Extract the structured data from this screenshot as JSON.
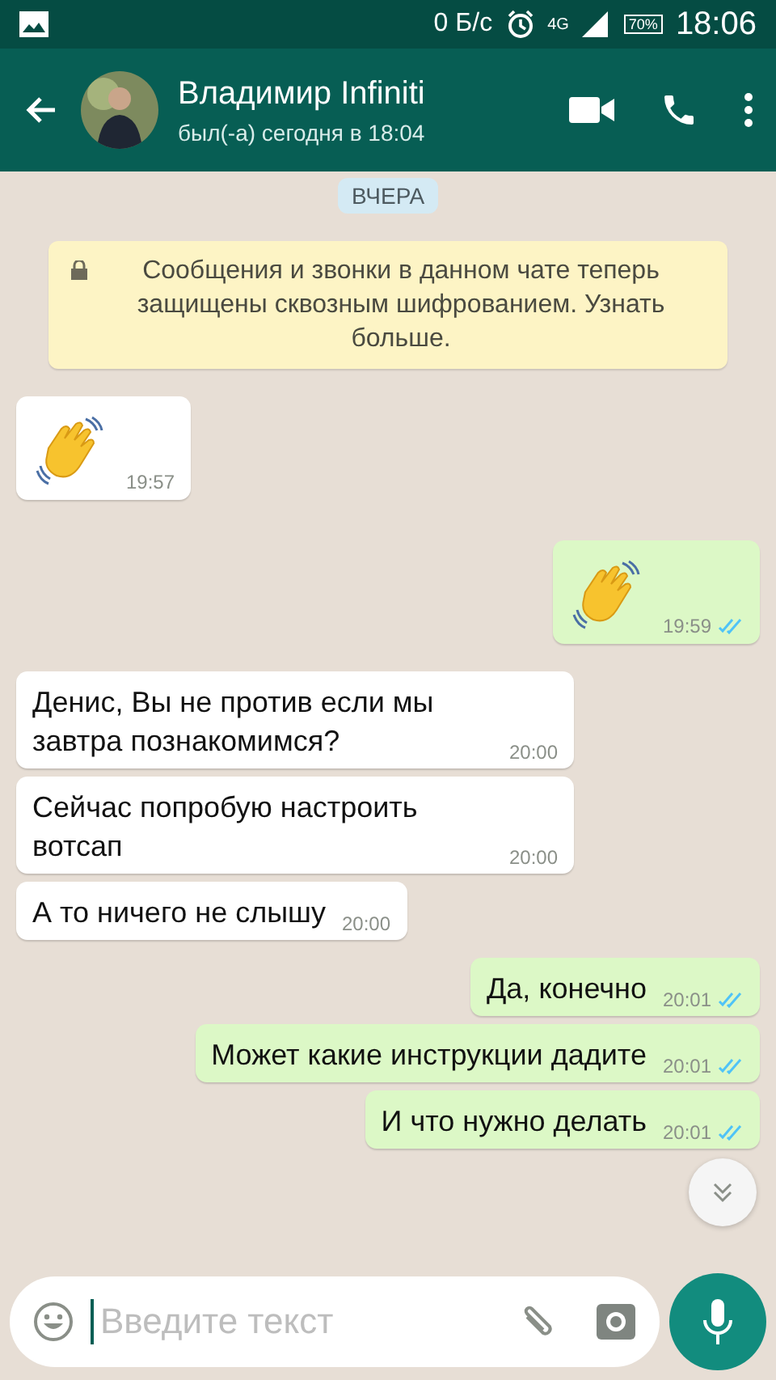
{
  "status_bar": {
    "speed": "0 Б/с",
    "network": "4G",
    "battery": "70%",
    "time": "18:06"
  },
  "header": {
    "name": "Владимир Infiniti",
    "last_seen": "был(-а) сегодня в 18:04"
  },
  "date_chip": "ВЧЕРА",
  "notice": "Сообщения и звонки в данном чате теперь защищены сквозным шифрованием. Узнать больше.",
  "messages": [
    {
      "kind": "emoji",
      "outgoing": false,
      "time": "19:57"
    },
    {
      "kind": "emoji",
      "outgoing": true,
      "time": "19:59",
      "read": true
    },
    {
      "kind": "text",
      "outgoing": false,
      "text": "Денис, Вы не против если мы завтра познакомимся?",
      "time": "20:00"
    },
    {
      "kind": "text",
      "outgoing": false,
      "text": "Сейчас попробую настроить вотсап",
      "time": "20:00"
    },
    {
      "kind": "text",
      "outgoing": false,
      "text": "А то ничего не слышу",
      "time": "20:00"
    },
    {
      "kind": "text",
      "outgoing": true,
      "text": "Да, конечно",
      "time": "20:01",
      "read": true
    },
    {
      "kind": "text",
      "outgoing": true,
      "text": "Может какие инструкции дадите",
      "time": "20:01",
      "read": true
    },
    {
      "kind": "text",
      "outgoing": true,
      "text": "И что нужно делать",
      "time": "20:01",
      "read": true
    }
  ],
  "composer": {
    "placeholder": "Введите текст"
  }
}
